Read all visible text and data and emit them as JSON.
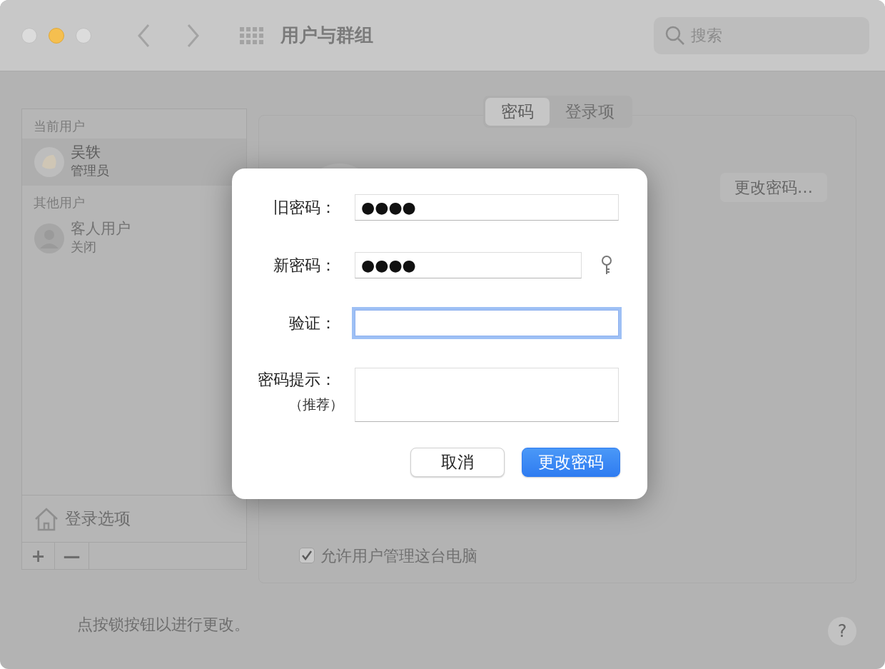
{
  "window": {
    "title": "用户与群组"
  },
  "search": {
    "placeholder": "搜索"
  },
  "sidebar": {
    "sections": [
      {
        "header": "当前用户",
        "users": [
          {
            "name": "吴轶",
            "role": "管理员",
            "selected": true,
            "kind": "admin"
          }
        ]
      },
      {
        "header": "其他用户",
        "users": [
          {
            "name": "客人用户",
            "role": "关闭",
            "selected": false,
            "kind": "guest"
          }
        ]
      }
    ],
    "login_options": "登录选项",
    "add": "+",
    "remove": "—"
  },
  "tabs": [
    {
      "label": "密码",
      "selected": true
    },
    {
      "label": "登录项",
      "selected": false
    }
  ],
  "change_password_button": "更改密码…",
  "admin_checkbox": {
    "label": "允许用户管理这台电脑",
    "checked": true
  },
  "lock_hint": "点按锁按钮以进行更改。",
  "help": "?",
  "dialog": {
    "fields": [
      {
        "kind": "secure",
        "label": "旧密码：",
        "value": "●●●●",
        "focused": false,
        "key_button": false
      },
      {
        "kind": "secure",
        "label": "新密码：",
        "value": "●●●●",
        "focused": false,
        "key_button": true
      },
      {
        "kind": "secure",
        "label": "验证：",
        "focused": true,
        "key_button": false
      },
      {
        "kind": "hint",
        "label": "密码提示：",
        "sublabel": "（推荐）",
        "focused": false,
        "key_button": false
      }
    ],
    "buttons": [
      {
        "label": "取消",
        "primary": false
      },
      {
        "label": "更改密码",
        "primary": true
      }
    ]
  }
}
